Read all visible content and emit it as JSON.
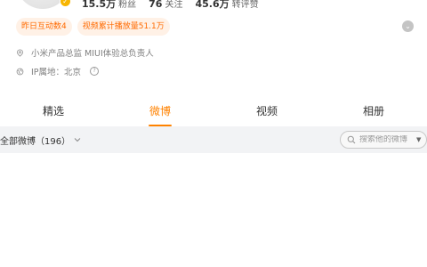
{
  "profile": {
    "stats": [
      {
        "value": "15.5万",
        "label": "粉丝"
      },
      {
        "value": "76",
        "label": "关注"
      },
      {
        "value": "45.6万",
        "label": "转评赞"
      }
    ],
    "badges": [
      "昨日互动数4",
      "视频累计播放量51.1万"
    ],
    "title": "小米产品总监 MIUI体验总负责人",
    "ip": "IP属地：北京"
  },
  "tabs": [
    {
      "label": "精选",
      "active": false
    },
    {
      "label": "微博",
      "active": true
    },
    {
      "label": "视频",
      "active": false
    },
    {
      "label": "相册",
      "active": false
    }
  ],
  "filter": {
    "label": "全部微博（196）",
    "search_placeholder": "搜索他的微博"
  },
  "colors": {
    "accent": "#ff8200",
    "badge_bg": "#fff1e6",
    "badge_text": "#ff6a00",
    "verified": "#f7b500"
  }
}
